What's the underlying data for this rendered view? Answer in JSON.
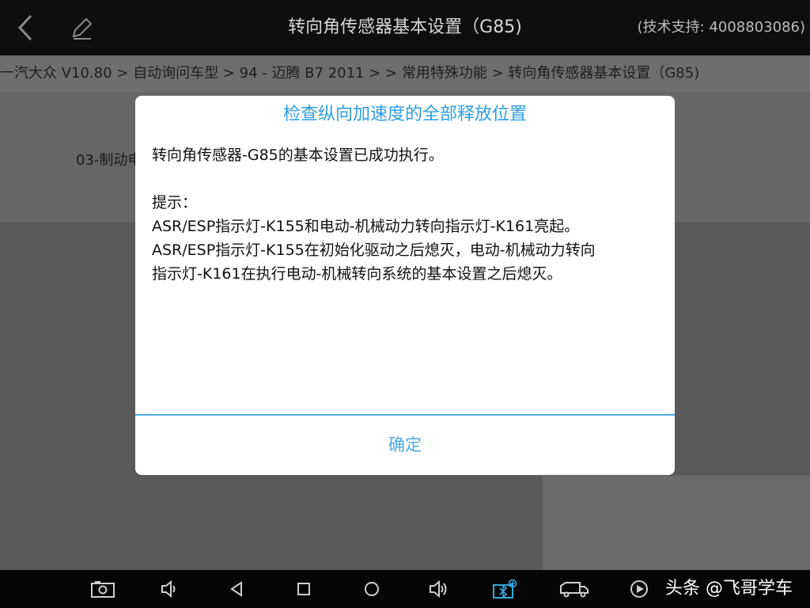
{
  "header": {
    "title": "转向角传感器基本设置（G85)",
    "support": "(技术支持: 4008803086)"
  },
  "breadcrumb": {
    "text": "一汽大众 V10.80 > 自动询问车型 > 94 - 迈腾 B7 2011 > > 常用特殊功能 > 转向角传感器基本设置（G85)"
  },
  "background_list": {
    "item": "03-制动电"
  },
  "dialog": {
    "title": "检查纵向加速度的全部释放位置",
    "lines": [
      "转向角传感器-G85的基本设置已成功执行。",
      "",
      "提示：",
      "ASR/ESP指示灯-K155和电动-机械动力转向指示灯-K161亮起。",
      "ASR/ESP指示灯-K155在初始化驱动之后熄灭，电动-机械动力转向",
      "指示灯-K161在执行电动-机械转向系统的基本设置之后熄灭。"
    ],
    "ok_label": "确定"
  },
  "navbar": {
    "icons": [
      "screenshot-icon",
      "volume-down-icon",
      "back-icon",
      "home-icon",
      "recents-icon",
      "volume-up-icon",
      "vci-bluetooth-icon",
      "truck-icon",
      "play-icon"
    ]
  },
  "watermark": {
    "text": "头条 @飞哥学车"
  },
  "colors": {
    "accent": "#2f9ee0",
    "dialog_bg": "#ffffff",
    "topbar_bg": "#0e0e0e"
  }
}
